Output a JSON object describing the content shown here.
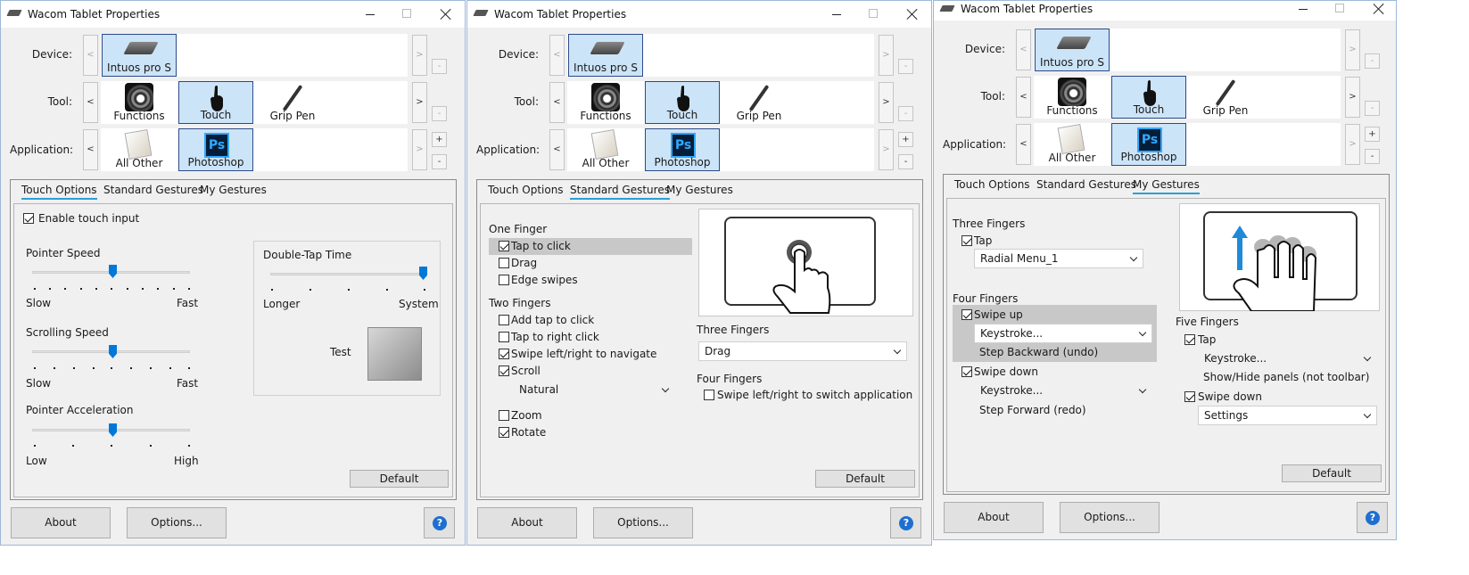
{
  "title": "Wacom Tablet Properties",
  "labels": {
    "device": "Device:",
    "tool": "Tool:",
    "application": "Application:"
  },
  "nav": {
    "prev": "<",
    "next": ">",
    "plus": "+",
    "minus": "-"
  },
  "device_name": "Intuos pro S",
  "tools": [
    "Functions",
    "Touch",
    "Grip Pen"
  ],
  "apps": [
    "All Other",
    "Photoshop"
  ],
  "tabs": [
    "Touch Options",
    "Standard Gestures",
    "My Gestures"
  ],
  "buttons": {
    "about": "About",
    "options": "Options...",
    "default": "Default",
    "help": "?"
  },
  "icons": {
    "device": "tablet-icon",
    "functions": "functions-icon",
    "touch": "touch-hand-icon",
    "pen": "grip-pen-icon",
    "other": "all-other-icon",
    "photoshop": "photoshop-icon",
    "photoshop_text": "Ps",
    "help": "help-icon"
  },
  "colors": {
    "accent": "#2aa0d5",
    "selection": "#cce4f7",
    "slider": "#0078d7"
  },
  "w1": {
    "active_tab": "Touch Options",
    "enable_touch": "Enable touch input",
    "pointer_speed": "Pointer Speed",
    "pointer_speed_value": 0.5,
    "slow": "Slow",
    "fast": "Fast",
    "scrolling_speed": "Scrolling Speed",
    "scrolling_speed_value": 0.5,
    "pointer_accel": "Pointer Acceleration",
    "pointer_accel_value": 0.5,
    "low": "Low",
    "high": "High",
    "double_tap": "Double-Tap Time",
    "double_tap_value": 1,
    "longer": "Longer",
    "system": "System",
    "test": "Test"
  },
  "w2": {
    "active_tab": "Standard Gestures",
    "one_finger": "One Finger",
    "tap_to_click": "Tap to click",
    "drag": "Drag",
    "edge_swipes": "Edge swipes",
    "two_fingers": "Two Fingers",
    "add_tap": "Add tap to click",
    "tap_right": "Tap to right click",
    "swipe_nav": "Swipe left/right to navigate",
    "scroll": "Scroll",
    "scroll_dir": "Natural",
    "zoom": "Zoom",
    "rotate": "Rotate",
    "three_fingers": "Three Fingers",
    "three_select": "Drag",
    "four_fingers": "Four Fingers",
    "swipe_switch": "Swipe left/right to switch application"
  },
  "w3": {
    "active_tab": "My Gestures",
    "three_fingers": "Three Fingers",
    "tap": "Tap",
    "radial_menu": "Radial Menu_1",
    "four_fingers": "Four Fingers",
    "swipe_up": "Swipe up",
    "keystroke": "Keystroke...",
    "step_backward": "Step Backward (undo)",
    "swipe_down": "Swipe down",
    "step_forward": "Step Forward (redo)",
    "five_fingers": "Five Fingers",
    "show_hide": "Show/Hide panels (not toolbar)",
    "settings": "Settings"
  }
}
